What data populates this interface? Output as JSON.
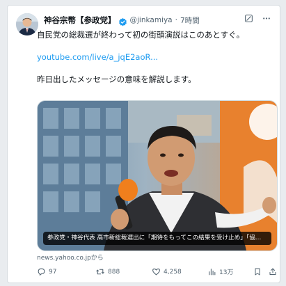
{
  "post": {
    "author_name": "神谷宗幣【参政党】",
    "handle": "@jinkamiya",
    "time": "7時間",
    "text_line1": "自民党の総裁選が終わって初の街頭演説はこのあとすぐ。",
    "link_text": "youtube.com/live/a_jqE2aoR...",
    "text_line3": "昨日出したメッセージの意味を解説します。"
  },
  "media": {
    "caption": "参政党・神谷代表 高市新総裁選出に「期待をもってこの結果を受け止め」「協…",
    "source": "news.yahoo.co.jpから"
  },
  "actions": {
    "replies": "97",
    "reposts": "888",
    "likes": "4,258",
    "views": "13万"
  },
  "icons": [
    "avatar",
    "verified-badge-icon",
    "grok-icon",
    "more-icon",
    "reply-icon",
    "repost-icon",
    "like-icon",
    "views-icon",
    "bookmark-icon",
    "share-icon"
  ],
  "colors": {
    "link": "#1d9bf0",
    "verified": "#1d9bf0",
    "muted": "#536471",
    "text": "#0f1419"
  }
}
